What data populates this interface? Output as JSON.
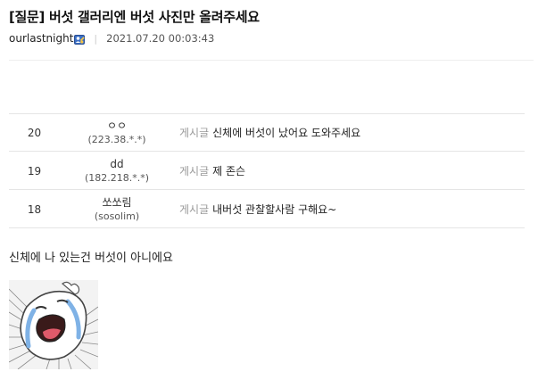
{
  "post": {
    "title": "[질문] 버섯 갤러리엔 버섯 사진만 올려주세요",
    "author": "ourlastnight",
    "author_badge_icon": "fixed-nickname-badge-icon",
    "separator": "|",
    "date": "2021.07.20 00:03:43"
  },
  "related_posts": [
    {
      "num": "20",
      "writer": "ㅇㅇ",
      "ip": "(223.38.*.*)",
      "prefix": "게시글",
      "title": "신체에 버섯이 났어요 도와주세요"
    },
    {
      "num": "19",
      "writer": "dd",
      "ip": "(182.218.*.*)",
      "prefix": "게시글",
      "title": "제 존슨"
    },
    {
      "num": "18",
      "writer": "쏘쏘림",
      "ip": "(sosolim)",
      "prefix": "게시글",
      "title": "내버섯 관찰할사람 구해요~"
    }
  ],
  "body": {
    "text": "신체에 나 있는건 버섯이 아니에요",
    "sticker_icon": "crying-character-sticker"
  },
  "colors": {
    "prefix_gray": "#999999",
    "divider": "#e5e5e5",
    "sticker_blue": "#7fb2e6"
  }
}
